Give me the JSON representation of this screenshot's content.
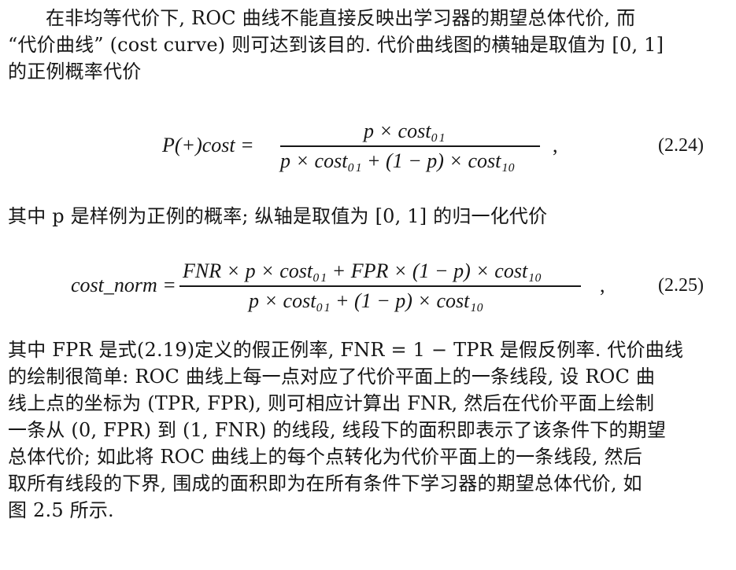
{
  "paragraph_1": {
    "lines": [
      "在非均等代价下, ROC 曲线不能直接反映出学习器的期望总体代价, 而",
      "“代价曲线” (cost curve) 则可达到该目的. 代价曲线图的横轴是取值为 [0, 1]",
      "的正例概率代价"
    ]
  },
  "equation_1": {
    "lhs": "P(+)cost =",
    "numerator": "p × cost₀₁",
    "denominator": "p × cost₀₁ + (1 − p) × cost₁₀",
    "trailing": ",",
    "number": "(2.24)"
  },
  "paragraph_2": {
    "text": "其中 p 是样例为正例的概率; 纵轴是取值为 [0, 1] 的归一化代价"
  },
  "equation_2": {
    "lhs": "cost_norm =",
    "numerator": "FNR × p × cost₀₁ + FPR × (1 − p) × cost₁₀",
    "denominator": "p × cost₀₁ + (1 − p) × cost₁₀",
    "trailing": ",",
    "number": "(2.25)"
  },
  "paragraph_3": {
    "lines": [
      "其中 FPR 是式(2.19)定义的假正例率, FNR = 1 − TPR 是假反例率. 代价曲线",
      "的绘制很简单: ROC 曲线上每一点对应了代价平面上的一条线段, 设 ROC 曲",
      "线上点的坐标为 (TPR, FPR), 则可相应计算出 FNR, 然后在代价平面上绘制",
      "一条从 (0, FPR) 到 (1, FNR) 的线段, 线段下的面积即表示了该条件下的期望",
      "总体代价; 如此将 ROC 曲线上的每个点转化为代价平面上的一条线段, 然后",
      "取所有线段的下界, 围成的面积即为在所有条件下学习器的期望总体代价, 如",
      "图 2.5 所示."
    ]
  }
}
